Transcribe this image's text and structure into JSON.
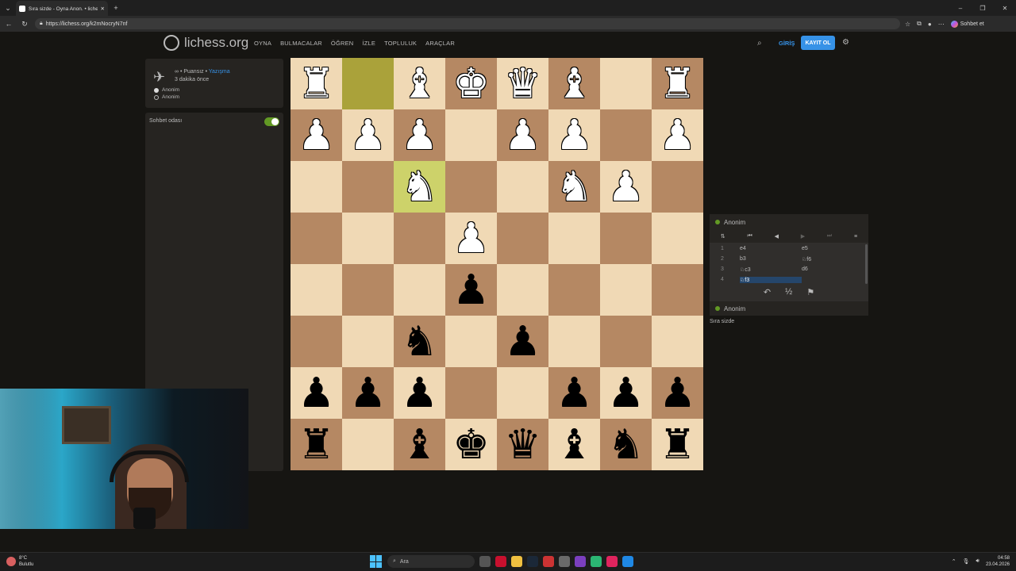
{
  "browser": {
    "tab_title": "Sıra sizde - Oyna Anon. • lichess.o",
    "url": "https://lichess.org/k2mNocryN7nf",
    "copilot_label": "Sohbet et"
  },
  "site": {
    "logo_text": "lichess.org",
    "nav": [
      "OYNA",
      "BULMACALAR",
      "ÖĞREN",
      "İZLE",
      "TOPLULUK",
      "ARAÇLAR"
    ],
    "signin": "GİRİŞ",
    "signup": "KAYIT OL"
  },
  "game_info": {
    "setup_symbol": "∞",
    "setup": "• Puansız •",
    "variant_link": "Yazışma",
    "time_ago": "3 dakika önce",
    "players": [
      "Anonim",
      "Anonim"
    ]
  },
  "chat": {
    "title": "Sohbet odası"
  },
  "board": {
    "ranks": [
      [
        {
          "p": "♜",
          "c": "w"
        },
        {
          "p": "",
          "c": "",
          "hl": true
        },
        {
          "p": "♝",
          "c": "w"
        },
        {
          "p": "♚",
          "c": "w"
        },
        {
          "p": "♛",
          "c": "w"
        },
        {
          "p": "♝",
          "c": "w"
        },
        {
          "p": "",
          "c": ""
        },
        {
          "p": "♜",
          "c": "w"
        }
      ],
      [
        {
          "p": "♟",
          "c": "w"
        },
        {
          "p": "♟",
          "c": "w"
        },
        {
          "p": "♟",
          "c": "w"
        },
        {
          "p": "",
          "c": ""
        },
        {
          "p": "♟",
          "c": "w"
        },
        {
          "p": "♟",
          "c": "w"
        },
        {
          "p": "",
          "c": ""
        },
        {
          "p": "♟",
          "c": "w"
        }
      ],
      [
        {
          "p": "",
          "c": ""
        },
        {
          "p": "",
          "c": ""
        },
        {
          "p": "♞",
          "c": "w",
          "hl": true
        },
        {
          "p": "",
          "c": ""
        },
        {
          "p": "",
          "c": ""
        },
        {
          "p": "♞",
          "c": "w"
        },
        {
          "p": "♟",
          "c": "w"
        },
        {
          "p": "",
          "c": ""
        }
      ],
      [
        {
          "p": "",
          "c": ""
        },
        {
          "p": "",
          "c": ""
        },
        {
          "p": "",
          "c": ""
        },
        {
          "p": "♟",
          "c": "w"
        },
        {
          "p": "",
          "c": ""
        },
        {
          "p": "",
          "c": ""
        },
        {
          "p": "",
          "c": ""
        },
        {
          "p": "",
          "c": ""
        }
      ],
      [
        {
          "p": "",
          "c": ""
        },
        {
          "p": "",
          "c": ""
        },
        {
          "p": "",
          "c": ""
        },
        {
          "p": "♟",
          "c": "b"
        },
        {
          "p": "",
          "c": ""
        },
        {
          "p": "",
          "c": ""
        },
        {
          "p": "",
          "c": ""
        },
        {
          "p": "",
          "c": ""
        }
      ],
      [
        {
          "p": "",
          "c": ""
        },
        {
          "p": "",
          "c": ""
        },
        {
          "p": "♞",
          "c": "b"
        },
        {
          "p": "",
          "c": ""
        },
        {
          "p": "♟",
          "c": "b"
        },
        {
          "p": "",
          "c": ""
        },
        {
          "p": "",
          "c": ""
        },
        {
          "p": "",
          "c": ""
        }
      ],
      [
        {
          "p": "♟",
          "c": "b"
        },
        {
          "p": "♟",
          "c": "b"
        },
        {
          "p": "♟",
          "c": "b"
        },
        {
          "p": "",
          "c": ""
        },
        {
          "p": "",
          "c": ""
        },
        {
          "p": "♟",
          "c": "b"
        },
        {
          "p": "♟",
          "c": "b"
        },
        {
          "p": "♟",
          "c": "b"
        }
      ],
      [
        {
          "p": "♜",
          "c": "b"
        },
        {
          "p": "",
          "c": ""
        },
        {
          "p": "♝",
          "c": "b"
        },
        {
          "p": "♚",
          "c": "b"
        },
        {
          "p": "♛",
          "c": "b"
        },
        {
          "p": "♝",
          "c": "b"
        },
        {
          "p": "♞",
          "c": "b"
        },
        {
          "p": "♜",
          "c": "b"
        }
      ]
    ]
  },
  "moves_panel": {
    "opponent": "Anonim",
    "self": "Anonim",
    "moves": [
      {
        "n": "1",
        "w": "e4",
        "b": "e5"
      },
      {
        "n": "2",
        "w": "b3",
        "b": "♘f6"
      },
      {
        "n": "3",
        "w": "♘c3",
        "b": "d6"
      },
      {
        "n": "4",
        "w": "♘f3",
        "b": ""
      }
    ],
    "active_move_index": 3,
    "draw_label": "½",
    "status": "Sıra sizde"
  },
  "taskbar": {
    "temp": "8°C",
    "weather": "Bulutlu",
    "search_placeholder": "Ara",
    "time": "04:58",
    "date": "23.04.2026"
  },
  "colors": {
    "accent": "#3692e7",
    "online": "#629924",
    "board_light": "#f0d9b5",
    "board_dark": "#b58863"
  }
}
